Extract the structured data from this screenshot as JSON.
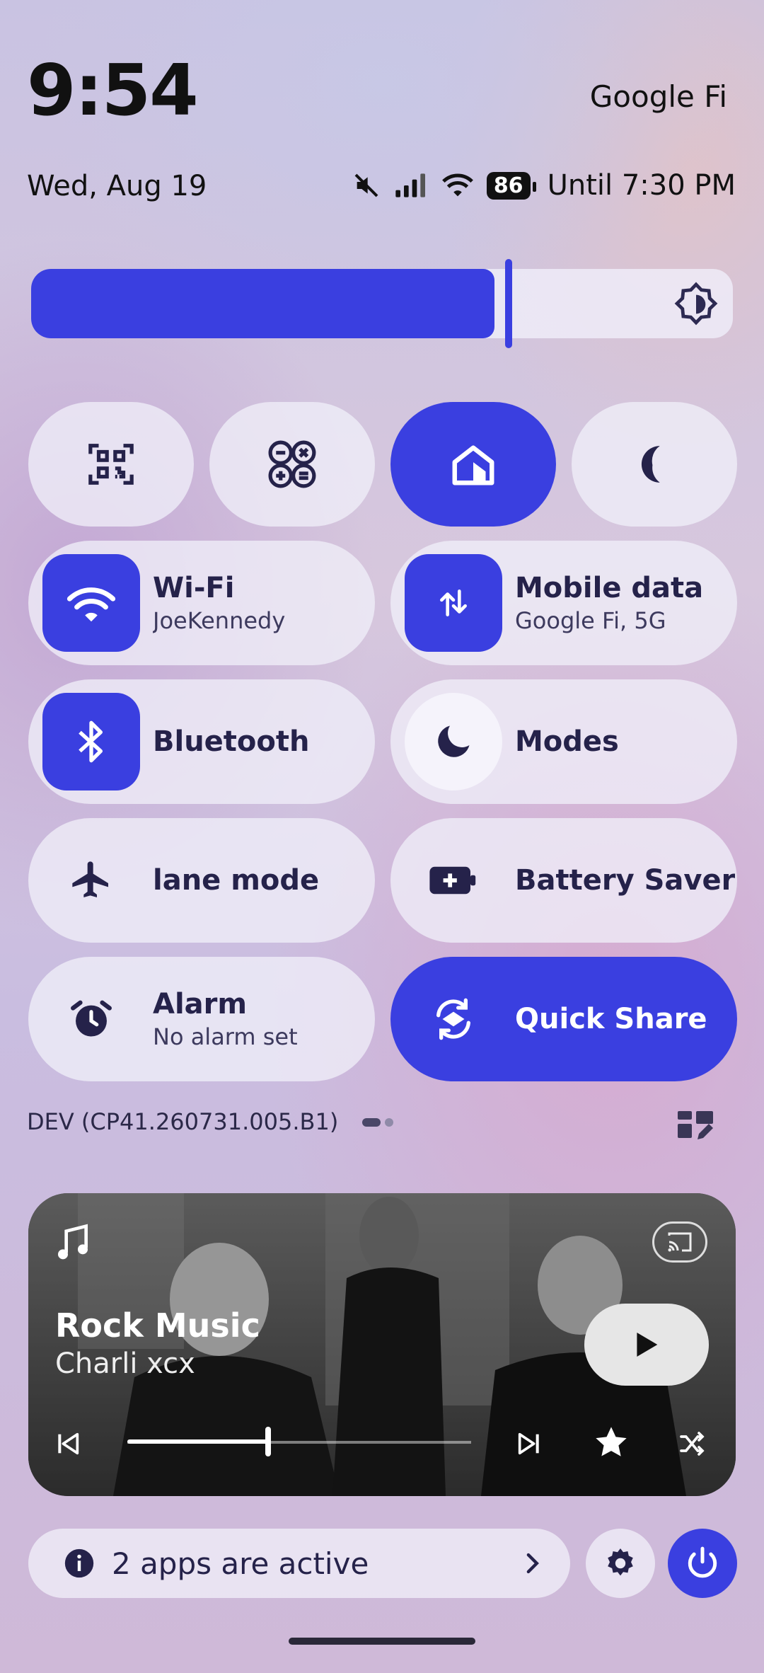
{
  "status": {
    "time": "9:54",
    "carrier": "Google Fi",
    "date": "Wed, Aug 19",
    "battery_level": "86",
    "battery_status": "Until 7:30 PM",
    "icons": [
      "mute-icon",
      "signal-icon",
      "wifi-icon",
      "battery-icon"
    ]
  },
  "brightness": {
    "level_fraction": 0.66,
    "icon": "brightness-icon"
  },
  "tiles_small": [
    {
      "name": "qr-scanner",
      "icon": "qr-code-icon",
      "on": false
    },
    {
      "name": "calculator",
      "icon": "calculator-icon",
      "on": false
    },
    {
      "name": "home",
      "icon": "home-icon",
      "on": true
    },
    {
      "name": "dark-theme",
      "icon": "moon-icon",
      "on": false
    }
  ],
  "tiles": {
    "wifi": {
      "label": "Wi-Fi",
      "sub": "JoeKennedy",
      "on": true
    },
    "mobile_data": {
      "label": "Mobile data",
      "sub": "Google Fi, 5G",
      "on": true
    },
    "bluetooth": {
      "label": "Bluetooth",
      "on": true
    },
    "modes": {
      "label": "Modes",
      "on": false
    },
    "airplane": {
      "label": "lane mode",
      "on": false
    },
    "battery_saver": {
      "label": "Battery Saver",
      "on": false
    },
    "alarm": {
      "label": "Alarm",
      "sub": "No alarm set",
      "on": false
    },
    "quick_share": {
      "label": "Quick Share",
      "on": true
    }
  },
  "footer": {
    "build": "DEV (CP41.260731.005.B1)",
    "pages": 2,
    "current_page": 1
  },
  "media": {
    "title": "Rock Music",
    "artist": "Charli xcx",
    "progress_fraction": 0.41
  },
  "bottom": {
    "active_apps": "2 apps are active"
  },
  "colors": {
    "accent": "#3a3fe0",
    "tile_bg": "#f0eef8",
    "text": "#25224a"
  }
}
